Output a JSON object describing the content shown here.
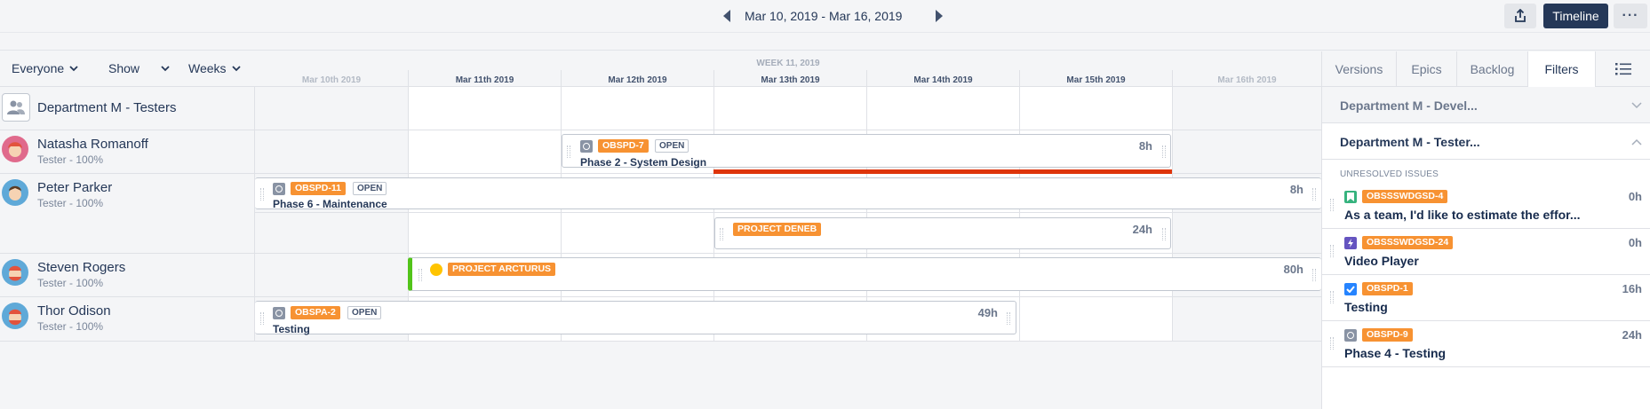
{
  "toolbar": {
    "date_range": "Mar 10, 2019 - Mar 16, 2019",
    "timeline_label": "Timeline",
    "more_label": "···"
  },
  "filters": {
    "everyone": "Everyone",
    "show": "Show",
    "weeks": "Weeks"
  },
  "calendar": {
    "week_label": "WEEK 11, 2019",
    "days": [
      "Mar 10th 2019",
      "Mar 11th 2019",
      "Mar 12th 2019",
      "Mar 13th 2019",
      "Mar 14th 2019",
      "Mar 15th 2019",
      "Mar 16th 2019"
    ]
  },
  "department": {
    "name": "Department M - Testers"
  },
  "people": [
    {
      "name": "Natasha Romanoff",
      "role": "Tester - 100%",
      "avatar_color": "#e06a8c"
    },
    {
      "name": "Peter Parker",
      "role": "Tester - 100%",
      "avatar_color": "#5fa9d8"
    },
    {
      "name": "Steven Rogers",
      "role": "Tester - 100%",
      "avatar_color": "#5fa9d8"
    },
    {
      "name": "Thor Odison",
      "role": "Tester - 100%",
      "avatar_color": "#5fa9d8"
    }
  ],
  "tasks": {
    "natasha": {
      "key": "OBSPD-7",
      "status": "OPEN",
      "name": "Phase 2 - System Design",
      "hours": "8h"
    },
    "peter_1": {
      "key": "OBSPD-11",
      "status": "OPEN",
      "name": "Phase 6 - Maintenance",
      "hours": "8h"
    },
    "peter_2": {
      "key": "PROJECT DENEB",
      "hours": "24h"
    },
    "steven": {
      "key": "PROJECT ARCTURUS",
      "hours": "80h"
    },
    "thor": {
      "key": "OBSPA-2",
      "status": "OPEN",
      "name": "Testing",
      "hours": "49h"
    }
  },
  "right_panel": {
    "tabs": [
      "Versions",
      "Epics",
      "Backlog",
      "Filters"
    ],
    "active_tab": "Filters",
    "groups": [
      "Department M - Devel...",
      "Department M - Tester..."
    ],
    "section_label": "UNRESOLVED ISSUES",
    "issues": [
      {
        "key": "OBSSSWDGSD-4",
        "title": "As a team, I'd like to estimate the effor...",
        "hours": "0h",
        "type_color": "#36b37e"
      },
      {
        "key": "OBSSSWDGSD-24",
        "title": "Video Player",
        "hours": "0h",
        "type_color": "#6554c0"
      },
      {
        "key": "OBSPD-1",
        "title": "Testing",
        "hours": "16h",
        "type_color": "#2684ff"
      },
      {
        "key": "OBSPD-9",
        "title": "Phase 4 - Testing",
        "hours": "24h",
        "type_color": "#8993a4"
      }
    ]
  },
  "colors": {
    "accent_dark": "#253858",
    "key_orange": "#f79232",
    "overbook_red": "#de350b",
    "progress_green": "#52c41a"
  }
}
